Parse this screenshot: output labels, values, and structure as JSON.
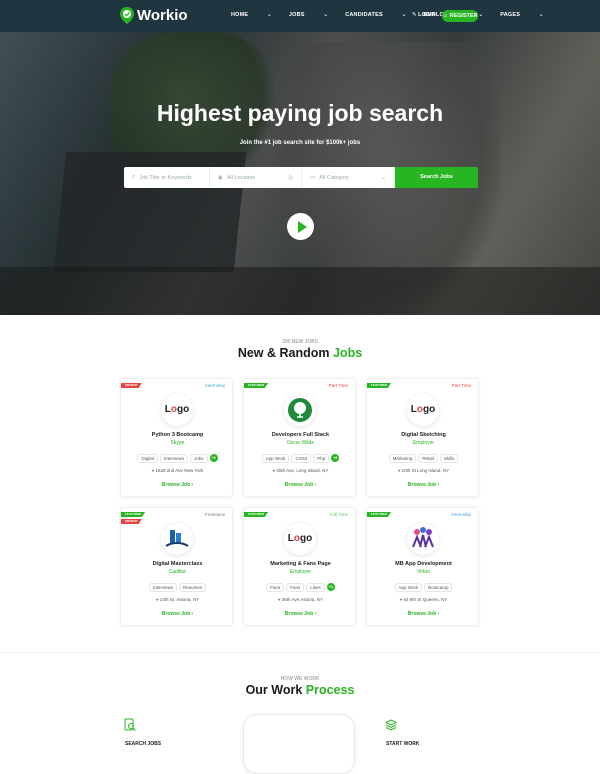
{
  "brand": {
    "name": "Workio"
  },
  "nav": {
    "items": [
      "HOME",
      "JOBS",
      "CANDIDATES",
      "EMPLOYERS",
      "PAGES"
    ],
    "login": "LOGIN",
    "register": "REGISTER"
  },
  "hero": {
    "title": "Highest paying job search",
    "subtitle": "Join the #1 job search site for $100k+ jobs",
    "search": {
      "keywords_placeholder": "Job Title or Keywords",
      "location_placeholder": "All Location",
      "category_placeholder": "All Category",
      "button": "Search Jobs"
    }
  },
  "jobs_section": {
    "kicker": "200 NEW JOBS",
    "title_main": "New & Random",
    "title_accent": "Jobs"
  },
  "jobs": [
    {
      "badges": [
        "URGENT"
      ],
      "badge_colors": [
        "red"
      ],
      "type": "Internship",
      "type_color": "blue",
      "logo": "logo-text",
      "title": "Python 3 Bootcamp",
      "company": "Skype",
      "skills": [
        "Digital",
        "Interviews",
        "Jobs"
      ],
      "more": "+3",
      "address": "1628 2nd Ave New York",
      "browse": "Browse Job"
    },
    {
      "badges": [
        "FEATURED"
      ],
      "badge_colors": [
        "grn"
      ],
      "type": "Part Time",
      "type_color": "red",
      "logo": "tree",
      "title": "Developers Full Stack",
      "company": "Oscar Wilde",
      "skills": [
        "App Work",
        "CSS3",
        "Php"
      ],
      "more": "+3",
      "address": "30th Ave, Long Island, NY",
      "browse": "Browse Job"
    },
    {
      "badges": [
        "FEATURED"
      ],
      "badge_colors": [
        "grn"
      ],
      "type": "Part Time",
      "type_color": "red",
      "logo": "logo-text",
      "title": "Digital Sketching",
      "company": "Employer",
      "skills": [
        "Marketing",
        "Retail",
        "Skills"
      ],
      "more": "",
      "address": "10th St Long Island, NY",
      "browse": "Browse Job"
    },
    {
      "badges": [
        "FEATURED",
        "URGENT"
      ],
      "badge_colors": [
        "grn",
        "red"
      ],
      "type": "Freelance",
      "type_color": "grey",
      "logo": "building",
      "title": "Digital Masterclass",
      "company": "Cadillac",
      "skills": [
        "Interviews",
        "Resumes"
      ],
      "more": "",
      "address": "14th St, Astoria, NY",
      "browse": "Browse Job"
    },
    {
      "badges": [
        "FEATURED"
      ],
      "badge_colors": [
        "grn"
      ],
      "type": "Full Time",
      "type_color": "green",
      "logo": "logo-text",
      "title": "Marketing & Fans Page",
      "company": "Employer",
      "skills": [
        "Face",
        "Fans",
        "Likes"
      ],
      "more": "+3",
      "address": "36th Ave Astoria, NY",
      "browse": "Browse Job"
    },
    {
      "badges": [
        "FEATURED"
      ],
      "badge_colors": [
        "grn"
      ],
      "type": "Internship",
      "type_color": "blue",
      "logo": "people",
      "title": "MB App Development",
      "company": "Virtue",
      "skills": [
        "App Work",
        "Bootcamp"
      ],
      "more": "",
      "address": "64 9th St Queens, NY",
      "browse": "Browse Job"
    }
  ],
  "process_section": {
    "kicker": "HOW WE WORK",
    "title_main": "Our Work",
    "title_accent": "Process",
    "steps": [
      {
        "label": "SEARCH JOBS",
        "icon": "search-doc-icon"
      },
      {
        "label": "START WORK",
        "icon": "layers-icon"
      }
    ]
  },
  "colors": {
    "accent": "#28b522",
    "nav": "#1f3540",
    "urgent": "#e74444"
  }
}
